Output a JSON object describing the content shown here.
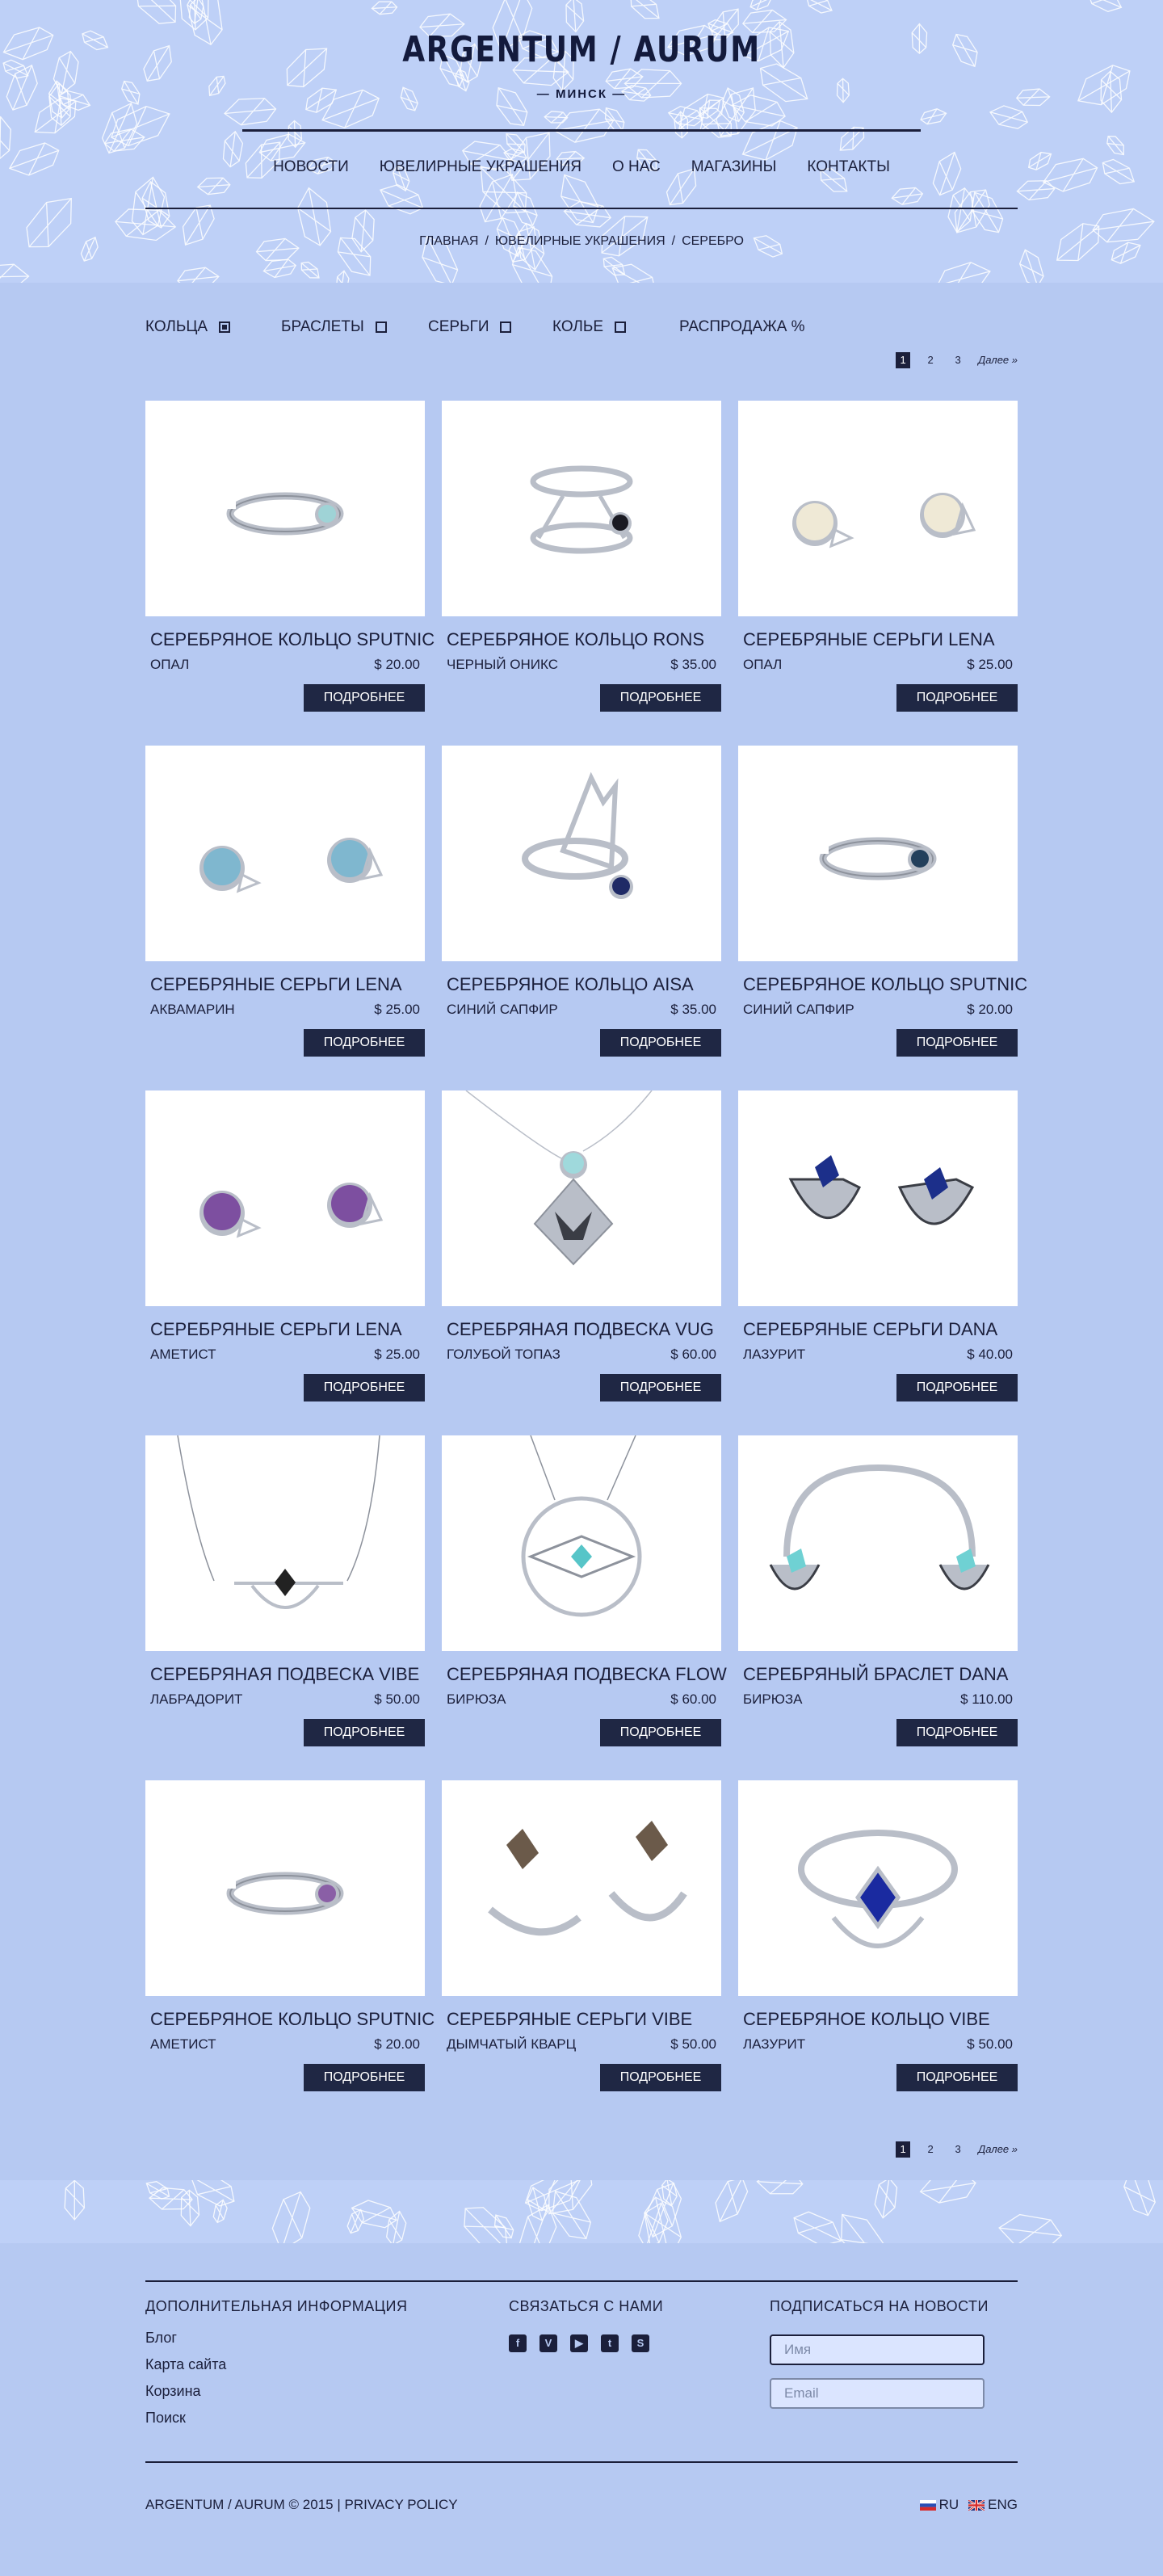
{
  "brand": {
    "logo": "ARGENTUM / AURUM",
    "city": "— МИНСК —"
  },
  "nav": [
    "НОВОСТИ",
    "ЮВЕЛИРНЫЕ УКРАШЕНИЯ",
    "О НАС",
    "МАГАЗИНЫ",
    "КОНТАКТЫ"
  ],
  "breadcrumb": [
    "ГЛАВНАЯ",
    "ЮВЕЛИРНЫЕ УКРАШЕНИЯ",
    "СЕРЕБРО"
  ],
  "breadcrumb_sep": "/",
  "filters": [
    {
      "label": "КОЛЬЦА",
      "checked": true
    },
    {
      "label": "БРАСЛЕТЫ",
      "checked": false
    },
    {
      "label": "СЕРЬГИ",
      "checked": false
    },
    {
      "label": "КОЛЬЕ",
      "checked": false
    },
    {
      "label": "РАСПРОДАЖА %"
    }
  ],
  "pagination": {
    "pages": [
      "1",
      "2",
      "3"
    ],
    "active": "1",
    "next": "Далее »"
  },
  "button_label": "ПОДРОБНЕЕ",
  "products": [
    {
      "name": "СЕРЕБРЯНОЕ КОЛЬЦО SPUTNIC",
      "stone": "ОПАЛ",
      "price": "$ 20.00",
      "kind": "ring",
      "gem": "#9fd3d6"
    },
    {
      "name": "СЕРЕБРЯНОЕ КОЛЬЦО RONS",
      "stone": "ЧЕРНЫЙ ОНИКС",
      "price": "$ 35.00",
      "kind": "ring2",
      "gem": "#1a1a22"
    },
    {
      "name": "СЕРЕБРЯНЫЕ СЕРЬГИ LENA",
      "stone": "ОПАЛ",
      "price": "$ 25.00",
      "kind": "earrings",
      "gem": "#efe9d6"
    },
    {
      "name": "СЕРЕБРЯНЫЕ СЕРЬГИ LENA",
      "stone": "АКВАМАРИН",
      "price": "$ 25.00",
      "kind": "earrings",
      "gem": "#7fb7cf"
    },
    {
      "name": "СЕРЕБРЯНОЕ КОЛЬЦО AISA",
      "stone": "СИНИЙ САПФИР",
      "price": "$ 35.00",
      "kind": "ring3",
      "gem": "#1f2a66"
    },
    {
      "name": "СЕРЕБРЯНОЕ КОЛЬЦО SPUTNIC",
      "stone": "СИНИЙ САПФИР",
      "price": "$ 20.00",
      "kind": "ring",
      "gem": "#23405c"
    },
    {
      "name": "СЕРЕБРЯНЫЕ СЕРЬГИ LENA",
      "stone": "АМЕТИСТ",
      "price": "$ 25.00",
      "kind": "earrings",
      "gem": "#7d4fa0"
    },
    {
      "name": "СЕРЕБРЯНАЯ ПОДВЕСКА VUG",
      "stone": "ГОЛУБОЙ ТОПАЗ",
      "price": "$ 60.00",
      "kind": "pendant",
      "gem": "#9fd9dc"
    },
    {
      "name": "СЕРЕБРЯНЫЕ СЕРЬГИ DANA",
      "stone": "ЛАЗУРИТ",
      "price": "$ 40.00",
      "kind": "dana",
      "gem": "#1c2f8a"
    },
    {
      "name": "СЕРЕБРЯНАЯ ПОДВЕСКА VIBE",
      "stone": "ЛАБРАДОРИТ",
      "price": "$ 50.00",
      "kind": "necklace",
      "gem": "#222222"
    },
    {
      "name": "СЕРЕБРЯНАЯ ПОДВЕСКА FLOW",
      "stone": "БИРЮЗА",
      "price": "$ 60.00",
      "kind": "flow",
      "gem": "#57c5c8"
    },
    {
      "name": "СЕРЕБРЯНЫЙ БРАСЛЕТ DANA",
      "stone": "БИРЮЗА",
      "price": "$ 110.00",
      "kind": "bracelet",
      "gem": "#6fd1d3"
    },
    {
      "name": "СЕРЕБРЯНОЕ КОЛЬЦО SPUTNIC",
      "stone": "АМЕТИСТ",
      "price": "$ 20.00",
      "kind": "ring",
      "gem": "#8a5fa6"
    },
    {
      "name": "СЕРЕБРЯНЫЕ СЕРЬГИ VIBE",
      "stone": "ДЫМЧАТЫЙ КВАРЦ",
      "price": "$ 50.00",
      "kind": "vibe",
      "gem": "#6b5a4a"
    },
    {
      "name": "СЕРЕБРЯНОЕ КОЛЬЦО VIBE",
      "stone": "ЛАЗУРИТ",
      "price": "$ 50.00",
      "kind": "ringvibe",
      "gem": "#1a2aa0"
    }
  ],
  "footer": {
    "info_title": "ДОПОЛНИТЕЛЬНАЯ ИНФОРМАЦИЯ",
    "info_links": [
      "Блог",
      "Карта сайта",
      "Корзина",
      "Поиск"
    ],
    "contact_title": "СВЯЗАТЬСЯ С НАМИ",
    "social": [
      {
        "icon": "facebook-icon",
        "glyph": "f"
      },
      {
        "icon": "vimeo-icon",
        "glyph": "V"
      },
      {
        "icon": "youtube-icon",
        "glyph": "▶"
      },
      {
        "icon": "twitter-icon",
        "glyph": "t"
      },
      {
        "icon": "skype-icon",
        "glyph": "S"
      }
    ],
    "subscribe_title": "ПОДПИСАТЬСЯ НА НОВОСТИ",
    "name_placeholder": "Имя",
    "email_placeholder": "Email",
    "copyright": "ARGENTUM / AURUM © 2015  |  PRIVACY POLICY",
    "lang_ru": "RU",
    "lang_en": "ENG"
  },
  "colors": {
    "page": "#b6c9f2",
    "header": "#bed0f7",
    "ink": "#1b1f3b",
    "button": "#1f2744"
  }
}
